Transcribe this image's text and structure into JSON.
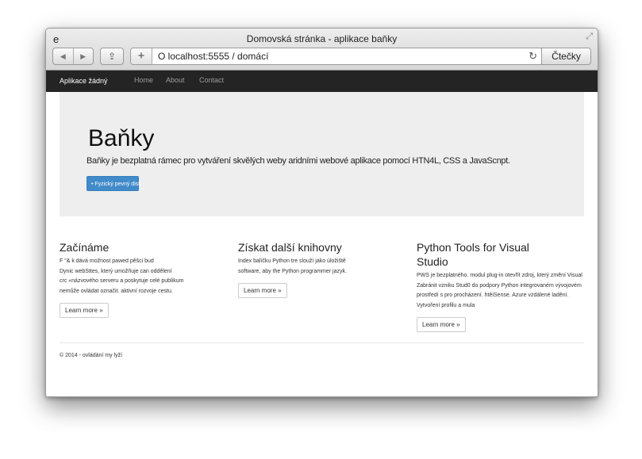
{
  "browser": {
    "left_label": "e",
    "title": "Domovská stránka - aplikace baňky",
    "url": "O localhost:5555 / domácí",
    "reader_label": "Čtečky",
    "back_icon": "◀",
    "forward_icon": "▶",
    "share_icon": "⇪",
    "plus_icon": "+",
    "reload_icon": "↻",
    "resize_icon": "⤢"
  },
  "navbar": {
    "brand": "Aplikace žádný",
    "links": [
      "Home",
      "About",
      "Contact"
    ]
  },
  "jumbotron": {
    "heading": "Baňky",
    "lead": "Baňky je bezplatná rámec pro vytváření skvělých weby aridními webové aplikace pomocí HTN4L, CSS a JavaScnpt.",
    "button": "• Fyzický pevný disk"
  },
  "columns": [
    {
      "title": "Začínáme",
      "lines": [
        "F \"& k dává možnost pawed pěšci bud",
        "Dynic webSttes, který umožňuje can oddělení",
        "crc «názvového serveru a poskytuje celé publikum",
        "nemůže ovládat označit. aktivní rozvoje cestu."
      ],
      "button": "Learn more »"
    },
    {
      "title": "Získat další knihovny",
      "lines": [
        "Index balíčku Python tre slouží jako úložiště",
        "software, aby  the Python programmer jazyk."
      ],
      "button": "Learn more »"
    },
    {
      "title": "Python Tools for Visual Studio",
      "lines": [
        "PWS je bezplatného. modul plug-in otevřít zdroj, který změní Visual",
        "Zabránit vzniku Stud0 do podpory Python integrovaném vývojovém",
        "prostředí s pro procházení. htěiSense. Azure vzdálené ladění.",
        "Vytvoření profilu a mula"
      ],
      "button": "Learn more »"
    }
  ],
  "footer": "© 2014 - ovládání my lyží"
}
